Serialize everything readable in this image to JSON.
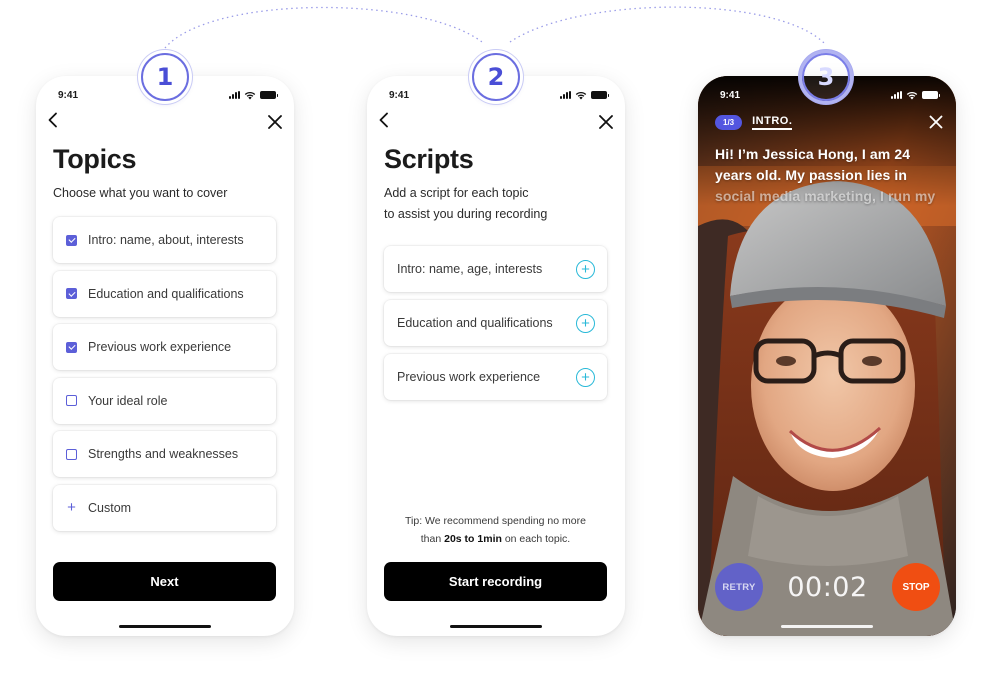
{
  "steps": [
    "1",
    "2",
    "3"
  ],
  "status_time": "9:41",
  "topics_screen": {
    "title": "Topics",
    "subtitle": "Choose what you want to cover",
    "items": [
      {
        "label": "Intro: name, about, interests",
        "checked": true
      },
      {
        "label": "Education and qualifications",
        "checked": true
      },
      {
        "label": "Previous work experience",
        "checked": true
      },
      {
        "label": "Your ideal role",
        "checked": false
      },
      {
        "label": "Strengths and weaknesses",
        "checked": false
      }
    ],
    "custom_label": "Custom",
    "next_label": "Next"
  },
  "scripts_screen": {
    "title": "Scripts",
    "subtitle_line1": "Add a script for each topic",
    "subtitle_line2": "to assist you during recording",
    "items": [
      {
        "label": "Intro: name, age, interests"
      },
      {
        "label": "Education and qualifications"
      },
      {
        "label": "Previous work experience"
      }
    ],
    "tip_prefix": "Tip: We recommend spending no more",
    "tip_than": "than",
    "tip_bold": "20s to 1min",
    "tip_suffix": "on each topic.",
    "start_label": "Start recording"
  },
  "recording_screen": {
    "progress_pill": "1/3",
    "tab_label": "INTRO.",
    "script_line1": "Hi! I’m Jessica Hong, I am 24",
    "script_line2": "years old. My passion lies in",
    "script_line3": "social media marketing, I run my",
    "retry_label": "RETRY",
    "timer": "00:02",
    "stop_label": "STOP"
  },
  "colors": {
    "accent": "#5c5fd8",
    "add_icon": "#29b9d8",
    "stop": "#f04e12",
    "primary_button": "#000000"
  }
}
